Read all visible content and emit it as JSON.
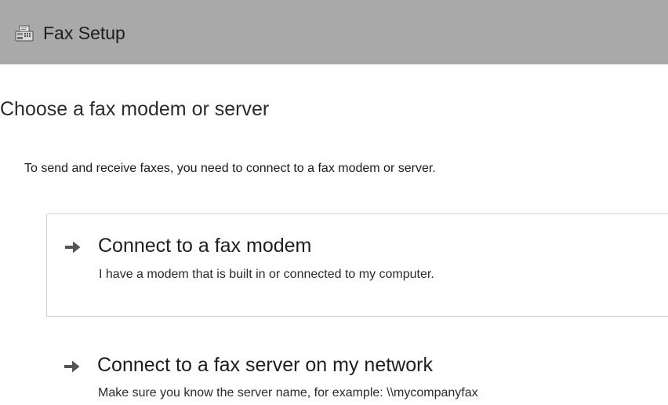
{
  "window": {
    "title": "Fax Setup",
    "icon": "fax-machine-icon"
  },
  "main": {
    "heading": "Choose a fax modem or server",
    "intro": "To send and receive faxes, you need to connect to a fax modem or server.",
    "options": [
      {
        "icon": "arrow-right-icon",
        "title": "Connect to a fax modem",
        "description": "I have a modem that is built in or connected to my computer."
      },
      {
        "icon": "arrow-right-icon",
        "title": "Connect to a fax server on my network",
        "description": "Make sure you know the server name, for example: \\\\mycompanyfax"
      }
    ]
  }
}
